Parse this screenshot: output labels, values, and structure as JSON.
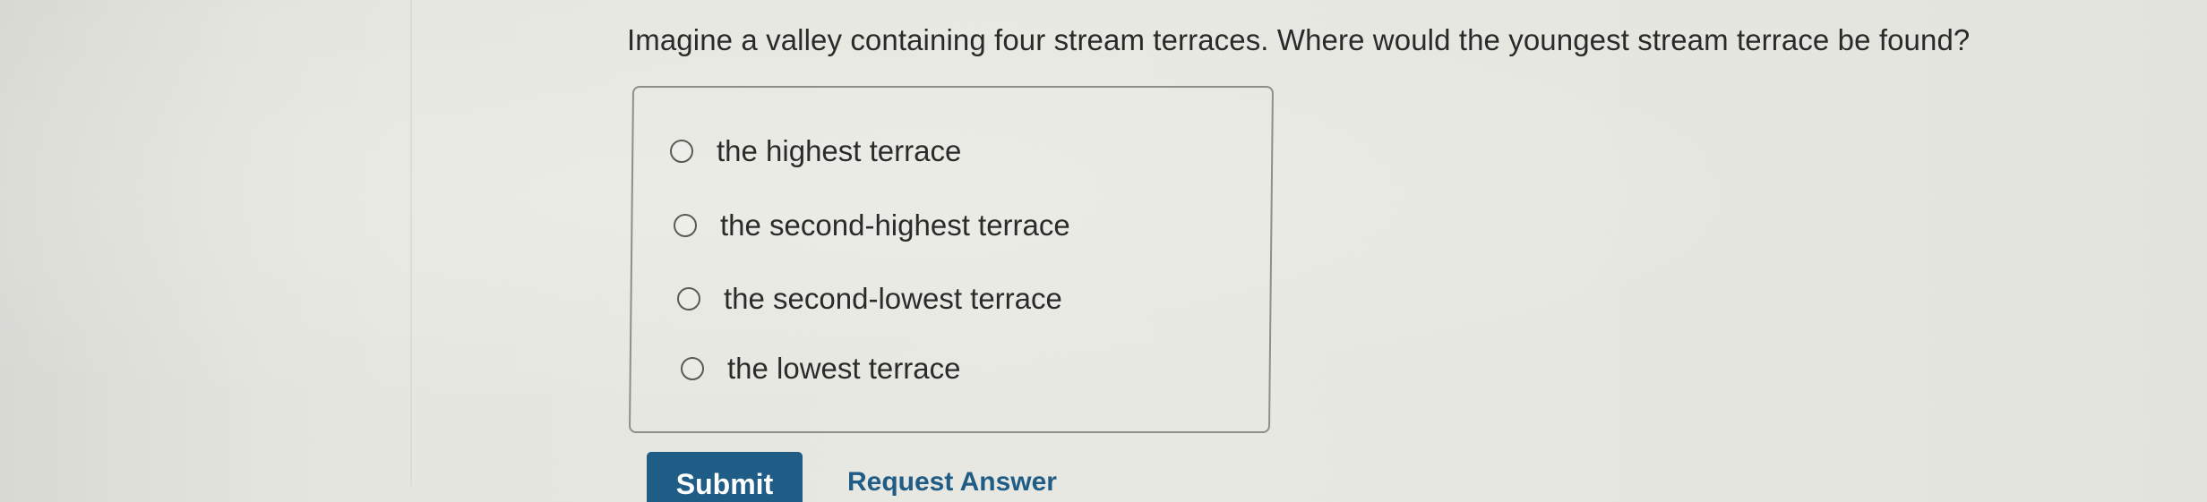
{
  "question": {
    "text": "Imagine a valley containing four stream terraces. Where would the youngest stream terrace be found?"
  },
  "choices": [
    {
      "label": "the highest terrace",
      "selected": false
    },
    {
      "label": "the second-highest terrace",
      "selected": false
    },
    {
      "label": "the second-lowest terrace",
      "selected": false
    },
    {
      "label": "the lowest terrace",
      "selected": false
    }
  ],
  "actions": {
    "submit_label": "Submit",
    "request_answer_label": "Request Answer"
  },
  "colors": {
    "accent": "#1f5d86",
    "text": "#2a2a2a",
    "background": "#e6e6e0"
  }
}
